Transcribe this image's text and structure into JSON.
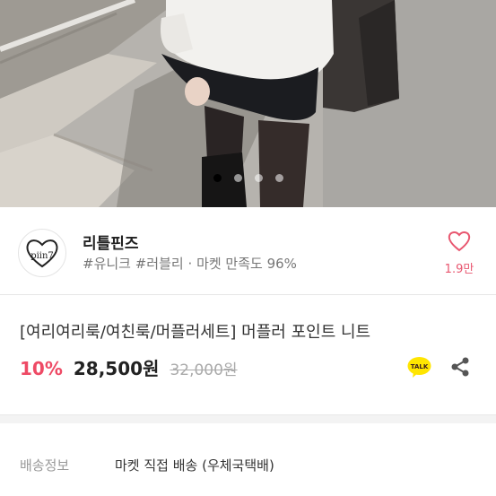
{
  "hero": {
    "slide_count": 4,
    "active_slide": 1
  },
  "shop": {
    "logo_text": "piin7",
    "name": "리틀핀즈",
    "tags": "#유니크 #러블리",
    "separator": "·",
    "satisfaction_label": "마켓 만족도 96%",
    "wish_count": "1.9만"
  },
  "product": {
    "title": "[여리여리룩/여친룩/머플러세트] 머플러 포인트 니트",
    "discount": "10%",
    "price": "28,500원",
    "original_price": "32,000원",
    "talk_label": "TALK"
  },
  "shipping": {
    "label": "배송정보",
    "value": "마켓 직접 배송 (우체국택배)"
  },
  "colors": {
    "accent": "#ee4a65",
    "heart": "#e8566f",
    "kakao": "#ffe500"
  },
  "icons": [
    "heart-icon",
    "kakao-talk-icon",
    "share-icon"
  ]
}
